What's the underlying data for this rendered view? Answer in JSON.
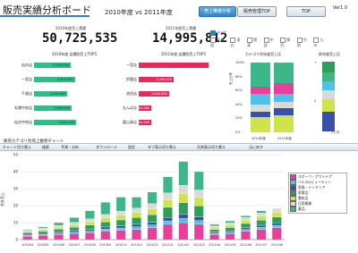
{
  "header": {
    "title": "販売実績分析ボード",
    "subtitle": "2010年度 vs 2011年度",
    "buttons": [
      {
        "label": "売上推移分析",
        "active": true
      },
      {
        "label": "販売管理TOP",
        "active": false
      },
      {
        "label": "TOP",
        "active": false
      }
    ],
    "version": "Ver1.0"
  },
  "totals": {
    "y2010": {
      "label": "2010年度売上実績",
      "value": "50,725,535"
    },
    "y2011": {
      "label": "2011年度売上実績",
      "value": "14,995,812"
    }
  },
  "region_filter": {
    "all": {
      "label": "すべて",
      "checked": true
    },
    "regions": [
      "北海道",
      "東北",
      "関東",
      "中部",
      "関西",
      "中国",
      "九州"
    ]
  },
  "top5_2010": {
    "title": "2010年度 店舗別売上TOP5",
    "stores": [
      {
        "name": "仙台店",
        "label": "3,500,000",
        "value": 3500000
      },
      {
        "name": "一宮店",
        "label": "3,900,000",
        "value": 3900000
      },
      {
        "name": "千歳店",
        "label": "3,200,000",
        "value": 3200000
      },
      {
        "name": "札幌中央店",
        "label": "3,600,000",
        "value": 3600000
      },
      {
        "name": "仙台中央店",
        "label": "4,041,100",
        "value": 4041100
      }
    ]
  },
  "top5_2011": {
    "title": "2011年度 店舗別売上TOP5",
    "stores": [
      {
        "name": "一宮店",
        "label": "",
        "value": 6000000
      },
      {
        "name": "鈴鹿店",
        "label": "3,000,000",
        "value": 3000000
      },
      {
        "name": "池田店",
        "label": "2,600,000",
        "value": 2600000
      },
      {
        "name": "なんば店",
        "label": "1,100,000",
        "value": 1100000
      },
      {
        "name": "富山高店",
        "label": "1,100,000",
        "value": 1100000
      }
    ]
  },
  "category_ratio": {
    "title": "カテゴリ別年度売上比",
    "ylabel": "売上比率",
    "yticks": [
      "100%",
      "80%",
      "60%",
      "40%",
      "20%",
      "0%"
    ],
    "years": [
      "2010年度",
      "2011年度"
    ]
  },
  "growth": {
    "title": "前年度売上比",
    "tick_top": "+",
    "tick_mid": "0",
    "xlabel": "1ヶ月"
  },
  "monthly": {
    "title": "販売カテゴリ別売上推移チャート",
    "toolbar": [
      "チャート切り替え",
      "検索",
      "予測・分析",
      "ダウンロード",
      "設定",
      "ダブ表示切り替え",
      "凡例表示切り替え",
      "元に戻す"
    ]
  },
  "colors": {
    "accent": "#2c86b8",
    "hbar2010": "#2fbf86",
    "hbar2011": "#e8295a",
    "cat1": "#e73f9a",
    "cat2": "#4fc1e8",
    "cat3": "#3a4fa8",
    "cat4": "#2e9e5b",
    "cat5": "#cfe34a",
    "cat6": "#d9d9d9",
    "cat7": "#3db68a"
  },
  "chart_data": {
    "type": "bar",
    "title": "販売カテゴリ別売上推移チャート",
    "ylabel": "合計売上",
    "ylim": [
      0,
      50
    ],
    "yticks": [
      0,
      10,
      20,
      30,
      40,
      50
    ],
    "categories": [
      "201004",
      "201005",
      "201006",
      "201007",
      "201008",
      "201009",
      "201010",
      "201011",
      "201012",
      "201101",
      "201102",
      "201103",
      "201104",
      "201105",
      "201106",
      "201107",
      "201108"
    ],
    "series": [
      {
        "name": "スポーツ・アウトドア",
        "color": "#e73f9a",
        "values": [
          2,
          2.5,
          3,
          3.5,
          4,
          5,
          5.5,
          6,
          7,
          9,
          10,
          9,
          3,
          3.5,
          5,
          6,
          7
        ]
      },
      {
        "name": "ヘルス&ビューティー",
        "color": "#4fc1e8",
        "values": [
          0.5,
          0.6,
          0.8,
          0.9,
          1,
          1.2,
          1.3,
          1.5,
          1.6,
          2,
          2.4,
          2.2,
          0.7,
          0.8,
          1,
          1.2,
          1.4
        ]
      },
      {
        "name": "家具・インテリア",
        "color": "#3a4fa8",
        "values": [
          0.5,
          0.6,
          0.8,
          0.9,
          1,
          1.2,
          1.3,
          1.5,
          1.6,
          2,
          2.4,
          2.2,
          0.7,
          0.8,
          1,
          1.2,
          1.4
        ]
      },
      {
        "name": "家電品",
        "color": "#2e9e5b",
        "values": [
          1,
          1.2,
          1.5,
          2,
          2.5,
          3,
          3.5,
          4,
          4.5,
          6,
          7,
          6.5,
          1.5,
          2,
          2.5,
          3,
          3.5
        ]
      },
      {
        "name": "食料品",
        "color": "#cfe34a",
        "values": [
          0.8,
          1,
          1.2,
          1.5,
          2,
          2.4,
          2.8,
          3,
          3.4,
          4.5,
          5.5,
          5,
          1.2,
          1.5,
          2,
          2.4,
          2.8
        ]
      },
      {
        "name": "日用雑貨",
        "color": "#d9d9d9",
        "values": [
          0.7,
          0.8,
          1,
          1.3,
          1.7,
          2,
          2.3,
          2.6,
          3,
          4,
          4.7,
          4.3,
          0.9,
          1.2,
          1.5,
          1.9,
          2.3
        ]
      },
      {
        "name": "薬品",
        "color": "#3db68a",
        "values": [
          0.5,
          0.8,
          1.7,
          2.9,
          4.8,
          7.2,
          8.3,
          6.4,
          6.9,
          9.5,
          14,
          10.8,
          1,
          1.2,
          1,
          1.3,
          -0.4
        ]
      }
    ]
  }
}
